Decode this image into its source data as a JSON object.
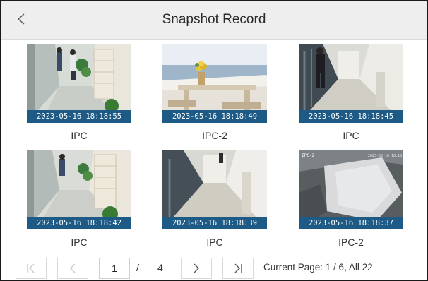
{
  "header": {
    "title": "Snapshot Record",
    "back_icon": "chevron-left-icon"
  },
  "snapshots": [
    {
      "timestamp": "2023-05-16 18:18:55",
      "camera": "IPC"
    },
    {
      "timestamp": "2023-05-16 18:18:49",
      "camera": "IPC-2"
    },
    {
      "timestamp": "2023-05-16 18:18:45",
      "camera": "IPC"
    },
    {
      "timestamp": "2023-05-16 18:18:42",
      "camera": "IPC"
    },
    {
      "timestamp": "2023-05-16 18:18:39",
      "camera": "IPC"
    },
    {
      "timestamp": "2023-05-16 18:18:37",
      "camera": "IPC-2"
    }
  ],
  "pager": {
    "first_icon": "first-page-icon",
    "prev_icon": "chevron-left-icon",
    "next_icon": "chevron-right-icon",
    "last_icon": "last-page-icon",
    "current_value": "1",
    "separator": "/",
    "total": "4",
    "info": "Current Page: 1 / 6, All 22"
  },
  "colors": {
    "stamp_bg": "#1d5a86",
    "header_bg": "#eeeeee",
    "disabled_icon": "#c8c8c8",
    "active_icon": "#555555"
  }
}
